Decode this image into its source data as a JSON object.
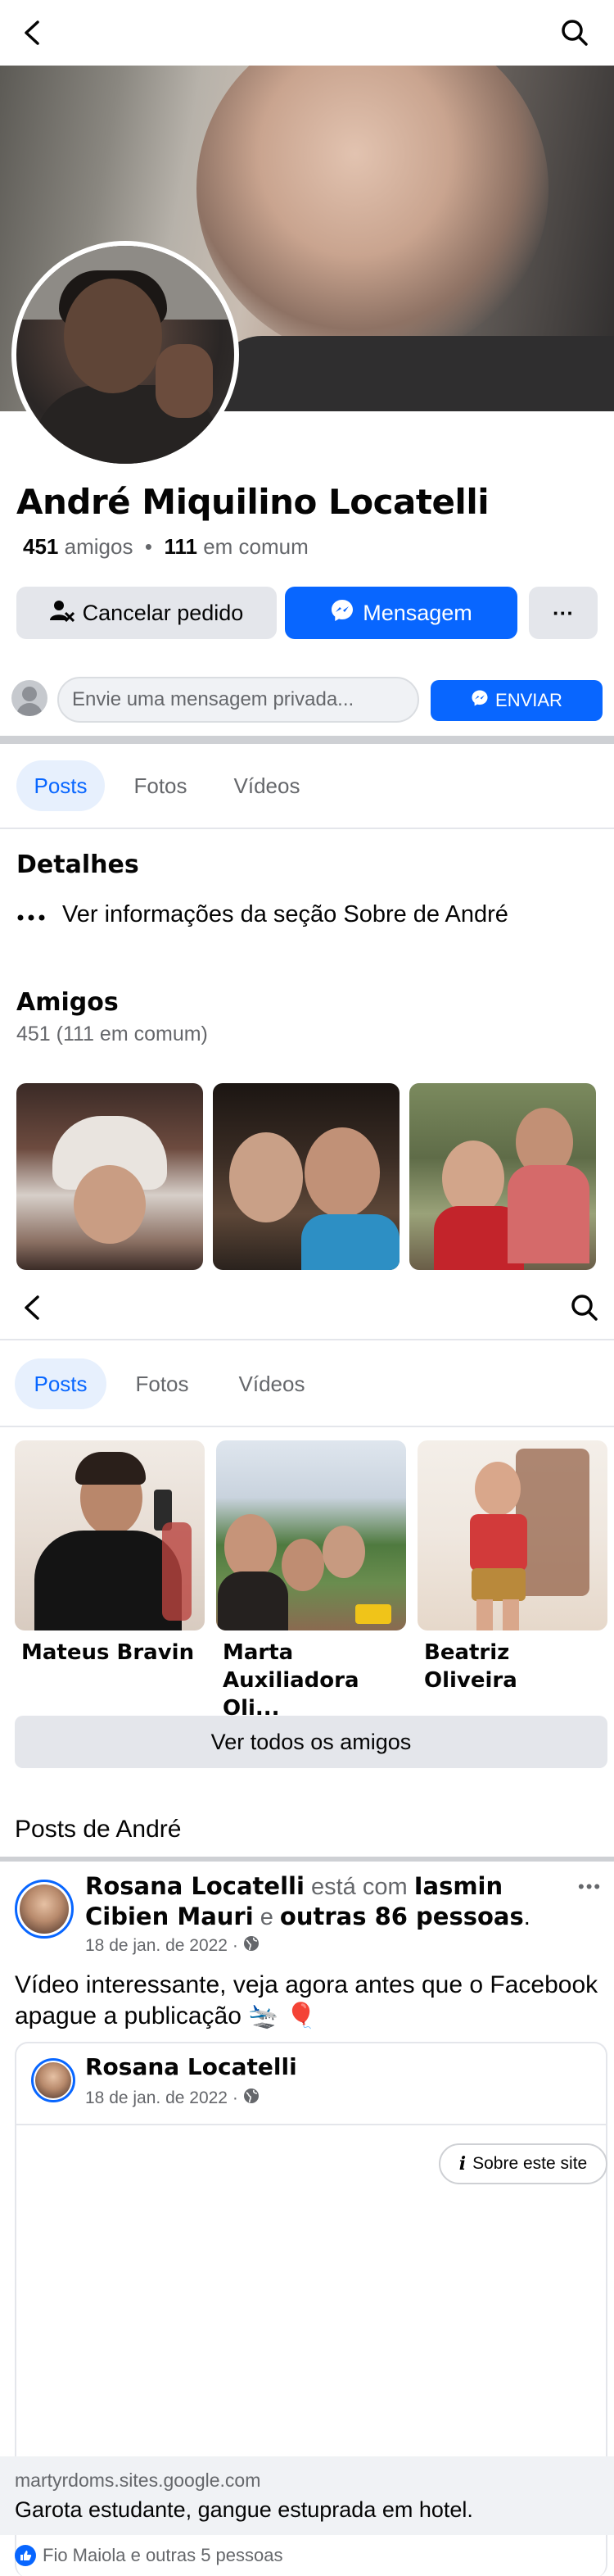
{
  "profile": {
    "name": "André Miquilino Locatelli",
    "friends_count": "451",
    "friends_label": "amigos",
    "separator": "•",
    "mutual_count": "111",
    "mutual_label": "em comum"
  },
  "actions": {
    "cancel_request": "Cancelar pedido",
    "message": "Mensagem",
    "more": "···"
  },
  "message_bar": {
    "placeholder": "Envie uma mensagem privada...",
    "send": "ENVIAR"
  },
  "tabs_top": [
    {
      "label": "Posts",
      "active": true
    },
    {
      "label": "Fotos",
      "active": false
    },
    {
      "label": "Vídeos",
      "active": false
    }
  ],
  "details": {
    "title": "Detalhes",
    "about_link": "Ver informações da seção Sobre de André"
  },
  "friends": {
    "title": "Amigos",
    "subtitle": "451 (111 em comum)",
    "list": [
      {
        "name": "Mateus Bravin"
      },
      {
        "name": "Marta Auxiliadora Oli..."
      },
      {
        "name": "Beatriz Oliveira"
      }
    ],
    "see_all": "Ver todos os amigos"
  },
  "tabs_sticky": [
    {
      "label": "Posts",
      "active": true
    },
    {
      "label": "Fotos",
      "active": false
    },
    {
      "label": "Vídeos",
      "active": false
    }
  ],
  "posts_section": {
    "title": "Posts de André"
  },
  "post": {
    "author": "Rosana Locatelli",
    "with_text": "está com",
    "tagged": "Iasmin Cibien Mauri",
    "and_text": "e",
    "others": "outras 86 pessoas",
    "period": ".",
    "date": "18 de jan. de 2022 ·",
    "text": "Vídeo interessante, veja agora antes que o Facebook apague a publicação",
    "emojis": "🛬 🎈",
    "more": "•••",
    "shared": {
      "author": "Rosana Locatelli",
      "date": "18 de jan. de 2022 ·",
      "about_site": "Sobre este site"
    },
    "link": {
      "domain": "martyrdoms.sites.google.com",
      "title": "Garota estudante, gangue estuprada em hotel."
    },
    "reactions": "Fio Maiola e outras 5 pessoas"
  },
  "colors": {
    "accent": "#0866ff",
    "secondary_text": "#65676b",
    "button_gray": "#e4e6eb"
  }
}
